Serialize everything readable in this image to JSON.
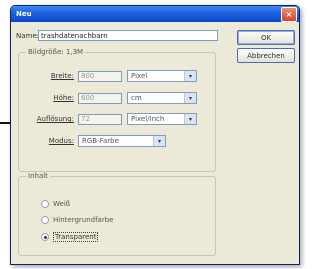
{
  "window": {
    "title": "Neu",
    "close_icon": "×"
  },
  "name_field": {
    "label": "Name:",
    "value": "trashdatenachbarn"
  },
  "buttons": {
    "ok": "OK",
    "reset": "Abbrechen"
  },
  "image_size": {
    "group_label": "Bildgröße: 1,3M",
    "width": {
      "label": "Breite:",
      "value": "800",
      "unit": "Pixel"
    },
    "height": {
      "label": "Höhe:",
      "value": "600",
      "unit": "cm"
    },
    "resolution": {
      "label": "Auflösung:",
      "value": "72",
      "unit": "Pixel/Inch"
    },
    "mode": {
      "label": "Modus:",
      "value": "RGB-Farbe"
    }
  },
  "content": {
    "group_label": "Inhalt",
    "options": [
      {
        "label": "Weiß",
        "selected": false
      },
      {
        "label": "Hintergrundfarbe",
        "selected": false
      },
      {
        "label": "Transparent",
        "selected": true
      }
    ]
  },
  "icons": {
    "dropdown": "▾",
    "pointer": "arrow-pointer-icon"
  }
}
